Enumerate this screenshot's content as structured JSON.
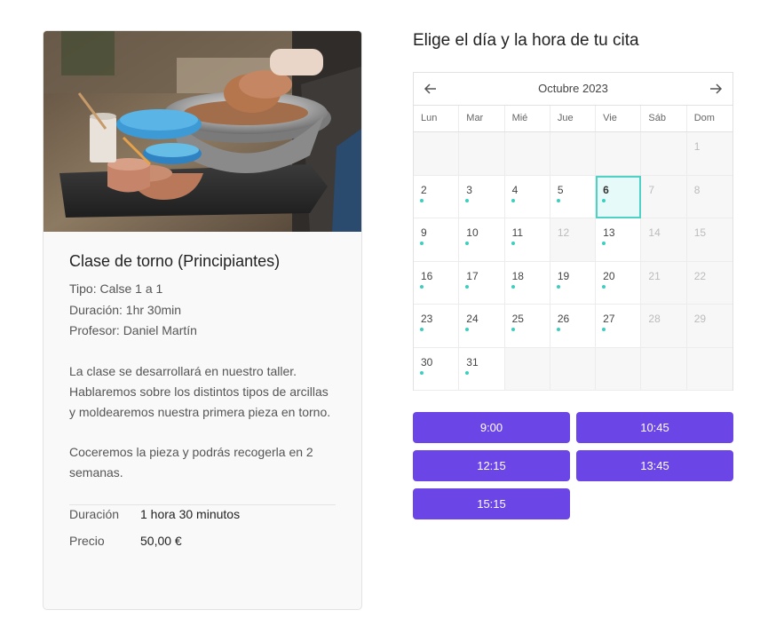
{
  "class_card": {
    "title": "Clase de torno (Principiantes)",
    "tipo": "Tipo: Calse 1 a 1",
    "duracion": "Duración: 1hr 30min",
    "profesor": "Profesor: Daniel Martín",
    "description_1": "La clase se desarrollará en nuestro taller. Hablaremos sobre los distintos tipos de arcillas y moldearemos nuestra primera pieza en torno.",
    "description_2": "Coceremos la pieza y podrás recogerla en 2 semanas.",
    "summary": [
      {
        "label": "Duración",
        "value": "1 hora 30 minutos"
      },
      {
        "label": "Precio",
        "value": "50,00 €"
      }
    ]
  },
  "booking": {
    "title": "Elige el día y la hora de tu cita",
    "month_label": "Octubre 2023",
    "prev_icon": "arrow-left-icon",
    "next_icon": "arrow-right-icon",
    "weekdays": [
      "Lun",
      "Mar",
      "Mié",
      "Jue",
      "Vie",
      "Sáb",
      "Dom"
    ],
    "leading_empty_days": 6,
    "days_in_month": 31,
    "past_days": [
      1
    ],
    "available_days": [
      2,
      3,
      4,
      5,
      6,
      9,
      10,
      11,
      13,
      16,
      17,
      18,
      19,
      20,
      23,
      24,
      25,
      26,
      27,
      30,
      31
    ],
    "selected_day": 6,
    "time_slots": [
      "9:00",
      "10:45",
      "12:15",
      "13:45",
      "15:15"
    ]
  },
  "colors": {
    "accent": "#6b45e6",
    "availability_dot": "#3bcfc0",
    "selected_border": "#4fd1c5",
    "selected_bg": "#e6fbf9"
  }
}
